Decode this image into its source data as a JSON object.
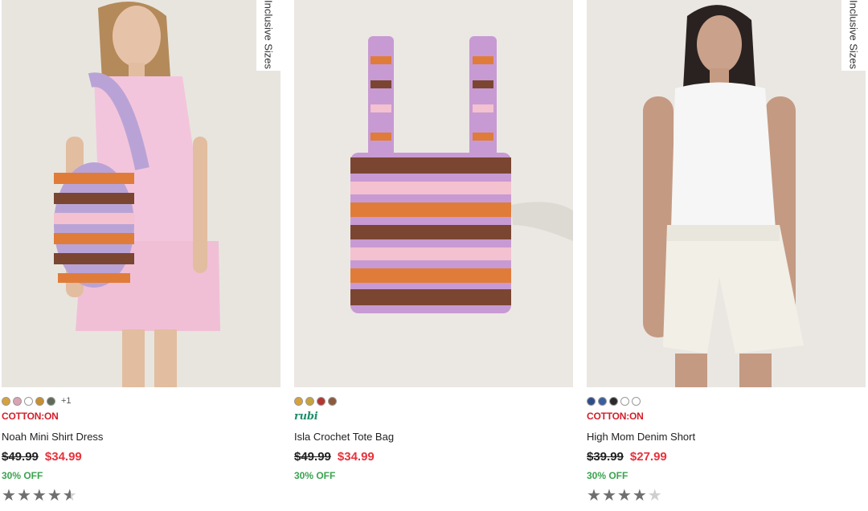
{
  "products": [
    {
      "tag": "Inclusive Sizes",
      "swatches": [
        "#d8a23a",
        "#dba3b4",
        "#ffffff",
        "#c7902c",
        "#5f6b5a"
      ],
      "more": "+1",
      "brand": "COTTON:ON",
      "name": "Noah Mini Shirt Dress",
      "was": "$49.99",
      "now": "$34.99",
      "discount": "30% OFF",
      "rating": 4.5
    },
    {
      "tag": "",
      "swatches": [
        "#d8a23a",
        "#c9a33a",
        "#b3362f",
        "#8c5a3c"
      ],
      "more": "",
      "brand": "rubi",
      "name": "Isla Crochet Tote Bag",
      "was": "$49.99",
      "now": "$34.99",
      "discount": "30% OFF",
      "rating": 0
    },
    {
      "tag": "Inclusive Sizes",
      "swatches": [
        "#2e4e8b",
        "#3a5f9f",
        "#2a2a2a",
        "#ffffff",
        "#ffffff"
      ],
      "more": "",
      "brand": "COTTON:ON",
      "name": "High Mom Denim Short",
      "was": "$39.99",
      "now": "$27.99",
      "discount": "30% OFF",
      "rating": 4
    }
  ],
  "icons": {
    "star": "star-icon",
    "swatch": "color-swatch"
  }
}
